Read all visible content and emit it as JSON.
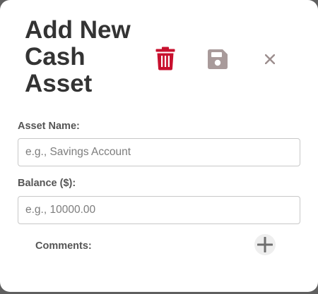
{
  "modal": {
    "title": "Add New Cash Asset"
  },
  "actions": {
    "delete_icon": "trash-icon",
    "save_icon": "floppy-disk-icon",
    "close_icon": "close-x-icon"
  },
  "form": {
    "name_label": "Asset Name:",
    "name_placeholder": "e.g., Savings Account",
    "name_value": "",
    "balance_label": "Balance ($):",
    "balance_placeholder": "e.g., 10000.00",
    "balance_value": "",
    "comments_label": "Comments:",
    "add_comment_icon": "plus-icon"
  },
  "colors": {
    "delete": "#c8102e",
    "save": "#a89a9a",
    "close": "#9c8e8e",
    "title": "#333333"
  }
}
